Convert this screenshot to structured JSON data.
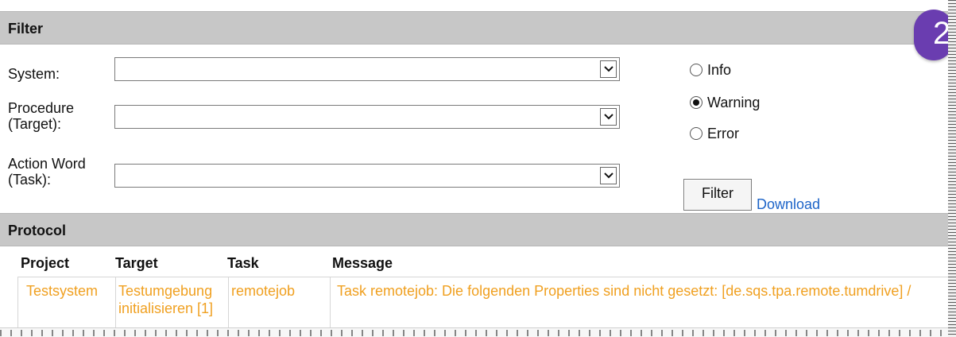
{
  "filter": {
    "title": "Filter",
    "system_label": "System:",
    "system_value": "",
    "procedure_label_line1": "Procedure",
    "procedure_label_line2": "(Target):",
    "procedure_value": "",
    "action_label_line1": "Action Word",
    "action_label_line2": "(Task):",
    "action_value": "",
    "levels": [
      {
        "label": "Info",
        "checked": false
      },
      {
        "label": "Warning",
        "checked": true
      },
      {
        "label": "Error",
        "checked": false
      }
    ],
    "filter_button": "Filter",
    "download_link": "Download"
  },
  "protocol": {
    "title": "Protocol",
    "columns": [
      "Project",
      "Target",
      "Task",
      "Message"
    ],
    "rows": [
      {
        "project": "Testsystem",
        "target_line1": "Testumgebung",
        "target_line2": "initialisieren [1]",
        "task": "remotejob",
        "message": "Task remotejob: Die folgenden Properties sind nicht gesetzt: [de.sqs.tpa.remote.tumdrive] /"
      }
    ]
  },
  "badge": {
    "number": "2"
  },
  "colors": {
    "section_bar": "#c7c7c7",
    "warning_text": "#f0a020",
    "link": "#1d64c8",
    "badge": "#6a3db0"
  }
}
